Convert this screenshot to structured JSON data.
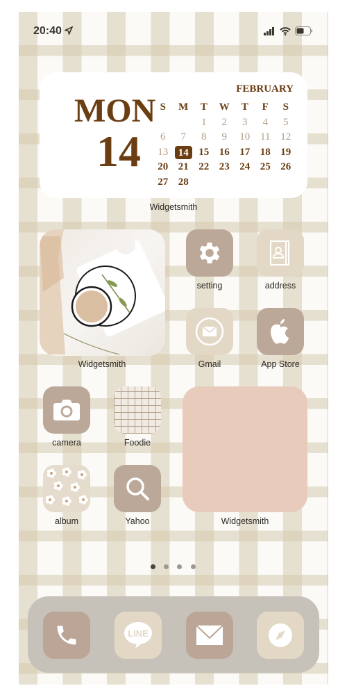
{
  "status": {
    "time": "20:40",
    "location_icon": "location-arrow-icon",
    "signal_icon": "signal-icon",
    "wifi_icon": "wifi-icon",
    "battery_icon": "battery-icon"
  },
  "calendar_widget": {
    "weekday": "MON",
    "day": "14",
    "month": "FEBRUARY",
    "weekdays": [
      "S",
      "M",
      "T",
      "W",
      "T",
      "F",
      "S"
    ],
    "days": [
      "",
      "",
      "1",
      "2",
      "3",
      "4",
      "5",
      "6",
      "7",
      "8",
      "9",
      "10",
      "11",
      "12",
      "13",
      "14",
      "15",
      "16",
      "17",
      "18",
      "19",
      "20",
      "21",
      "22",
      "23",
      "24",
      "25",
      "26",
      "27",
      "28"
    ],
    "today": "14",
    "label": "Widgetsmith"
  },
  "photo_widget": {
    "label": "Widgetsmith"
  },
  "apps": [
    {
      "label": "setting",
      "icon": "gear-icon"
    },
    {
      "label": "address",
      "icon": "contact-book-icon"
    },
    {
      "label": "Gmail",
      "icon": "mail-circle-icon"
    },
    {
      "label": "App Store",
      "icon": "apple-icon"
    },
    {
      "label": "camera",
      "icon": "camera-icon"
    },
    {
      "label": "Foodie",
      "icon": "grid-pattern-icon"
    },
    {
      "label": "album",
      "icon": "flower-pattern-icon"
    },
    {
      "label": "Yahoo",
      "icon": "search-icon"
    }
  ],
  "pink_widget": {
    "label": "Widgetsmith",
    "color": "#e8cbbb"
  },
  "page_dots": {
    "count": 4,
    "active": 0
  },
  "dock": {
    "apps": [
      {
        "icon": "phone-icon"
      },
      {
        "icon": "line-icon",
        "text": "LINE"
      },
      {
        "icon": "mail-icon"
      },
      {
        "icon": "compass-icon"
      }
    ]
  },
  "colors": {
    "brown": "#6b3d12",
    "icon_dark": "#bba899",
    "icon_light": "#e3d8c6",
    "dock": "#c6c2ba"
  }
}
